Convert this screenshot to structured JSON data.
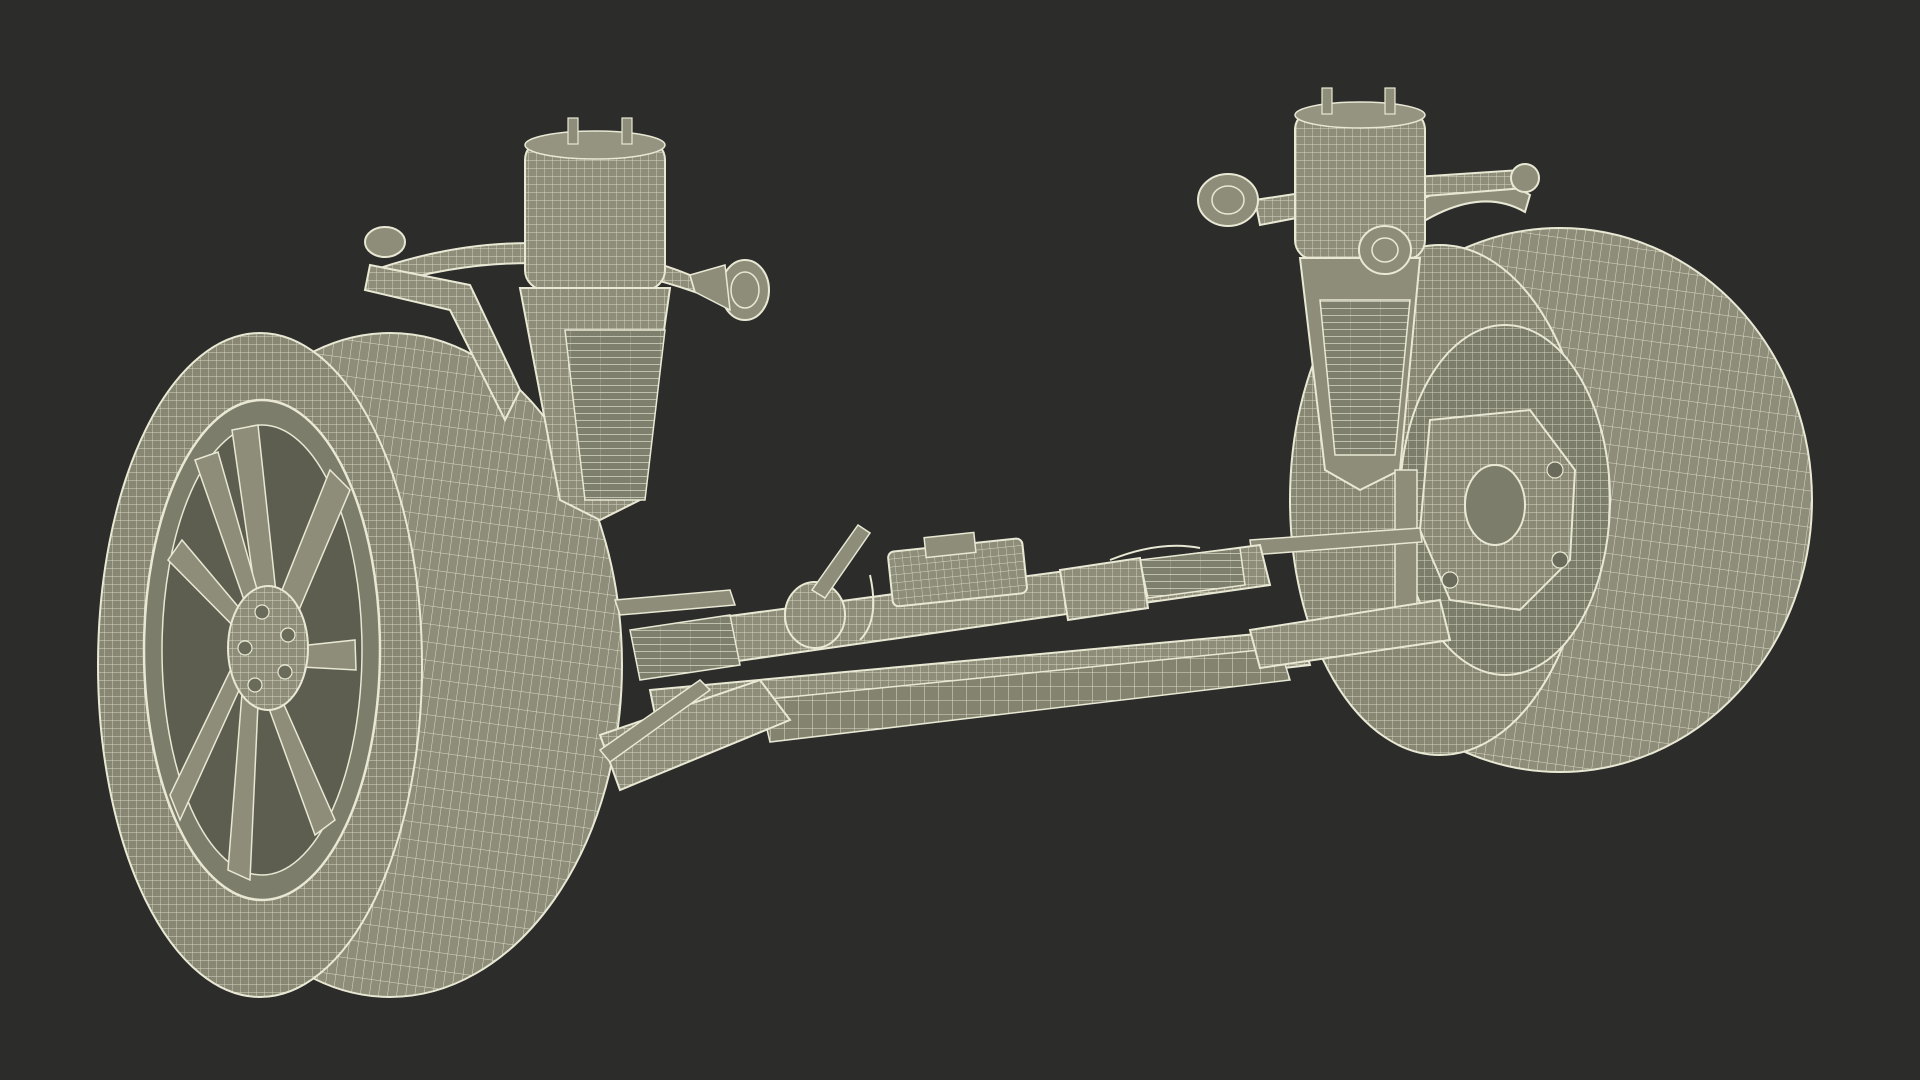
{
  "scene": {
    "background_color": "#2c2c2a",
    "mesh_fill_color": "#8d8d79",
    "mesh_shadow_color": "#6b6b5c",
    "wire_color": "#e8e8d4",
    "depicts": "wireframe-front-suspension-assembly"
  }
}
